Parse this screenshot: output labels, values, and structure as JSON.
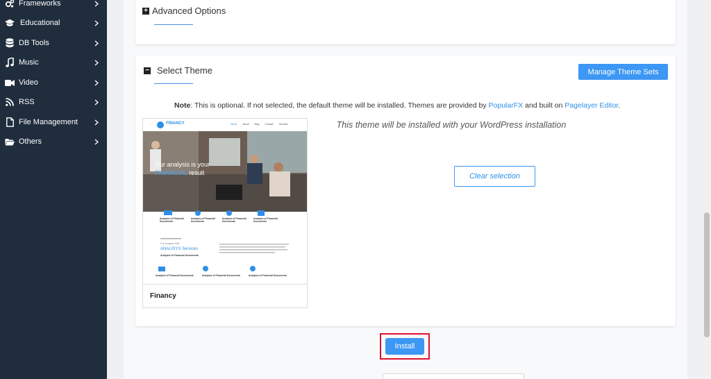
{
  "sidebar": {
    "items": [
      {
        "label": "Frameworks",
        "icon": "gears-icon"
      },
      {
        "label": "Educational",
        "icon": "graduation-cap-icon"
      },
      {
        "label": "DB Tools",
        "icon": "database-icon"
      },
      {
        "label": "Music",
        "icon": "music-note-icon"
      },
      {
        "label": "Video",
        "icon": "video-camera-icon"
      },
      {
        "label": "RSS",
        "icon": "rss-icon"
      },
      {
        "label": "File Management",
        "icon": "file-icon"
      },
      {
        "label": "Others",
        "icon": "folder-open-icon"
      }
    ]
  },
  "advanced": {
    "title": "Advanced Options"
  },
  "theme_section": {
    "title": "Select Theme",
    "manage_button": "Manage Theme Sets",
    "note_label": "Note",
    "note_text": ": This is optional. If not selected, the default theme will be installed. Themes are provided by ",
    "popularfx_link": "PopularFX",
    "note_mid": " and built on ",
    "pagelayer_link": "Pagelayer Editor",
    "note_end": ".",
    "selected_theme": {
      "name": "Financy",
      "preview": {
        "logo": "FINANCY",
        "nav": [
          "Home",
          "About",
          "Blog",
          "Contact",
          "Services"
        ],
        "hero_line1": "Our analysis is your",
        "hero_line2a": "FINANCIAL",
        "hero_line2b": " result",
        "features": [
          "Analysis of Financial Documents",
          "Analysis of Financial Documents",
          "Analysis of Financial Documents",
          "Analysis of Financial Documents"
        ],
        "services_kicker": "Our Analysis Skill",
        "services_title_a": "ANALISYS",
        "services_title_b": " Services",
        "services_sub": "Analysis of Financial Documents",
        "bottom_features": [
          "Analysis of Financial Documents",
          "Analysis of Financial Documents",
          "Analysis of Financial Documents"
        ]
      }
    },
    "install_message": "This theme will be installed with your WordPress installation",
    "clear_button": "Clear selection"
  },
  "install_button": "Install",
  "colors": {
    "sidebar_bg": "#1f2d3d",
    "accent": "#3d97f4",
    "highlight": "#e0102a"
  }
}
